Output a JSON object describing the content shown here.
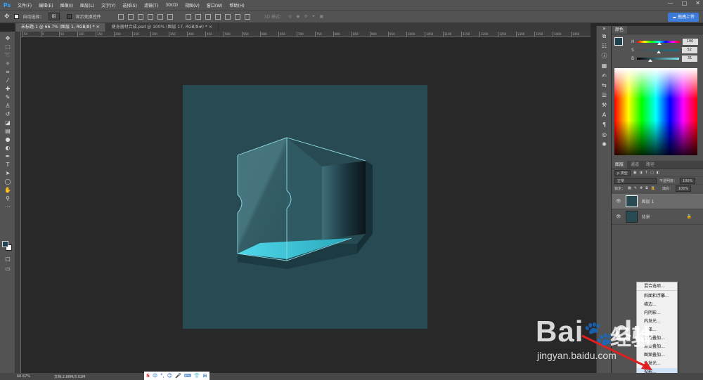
{
  "menubar": {
    "logo": "Ps",
    "items": [
      "文件(F)",
      "编辑(E)",
      "图像(I)",
      "图层(L)",
      "文字(Y)",
      "选择(S)",
      "滤镜(T)",
      "3D(D)",
      "视图(V)",
      "窗口(W)",
      "帮助(H)"
    ],
    "window_controls": [
      "—",
      "□",
      "✕"
    ]
  },
  "options": {
    "auto_select_label": "自动选择：",
    "auto_select_value": "组",
    "show_transform_label": "显示变换控件",
    "mode_label": "3D 模式：",
    "upload_label": "拖拽上传"
  },
  "tabs": [
    {
      "label": "未标题-1 @ 66.7% (图层 1, RGB/8) *",
      "close": "×"
    },
    {
      "label": "健身器材合成.psd @ 100% (图层 17, RGB/8#) *",
      "close": "×"
    }
  ],
  "ruler_ticks": [
    "50",
    "0",
    "50",
    "100",
    "150",
    "200",
    "250",
    "300",
    "350",
    "400",
    "450",
    "500",
    "550",
    "600",
    "650",
    "700",
    "750",
    "800",
    "850",
    "900",
    "950",
    "1000",
    "1050",
    "1100",
    "1150",
    "1200",
    "1250",
    "1300",
    "1350",
    "1400",
    "1450"
  ],
  "status": {
    "zoom": "66.67%",
    "doc": "文档:2.86M/3.02M"
  },
  "ime": {
    "logo": "S",
    "items": [
      "中",
      "°,",
      "☺",
      "🎤",
      "⌨",
      "👕",
      "⊞"
    ]
  },
  "color_panel": {
    "tab": "颜色",
    "h": {
      "label": "H",
      "value": "190",
      "pos": 0.53
    },
    "s": {
      "label": "S",
      "value": "52",
      "pos": 0.52
    },
    "b": {
      "label": "B",
      "value": "31",
      "pos": 0.31
    }
  },
  "layers_panel": {
    "tabs": [
      "图层",
      "通道",
      "路径"
    ],
    "filter_label": "ρ 类型",
    "blend_mode": "正常",
    "opacity_label": "不透明度：",
    "opacity_value": "100%",
    "lock_label": "锁定：",
    "fill_label": "填充：",
    "fill_value": "100%",
    "layers": [
      {
        "name": "图层 1",
        "selected": true
      },
      {
        "name": "背景",
        "selected": false,
        "locked": true
      }
    ]
  },
  "context_menu": [
    "混合选项...",
    "斜面和浮雕...",
    "描边...",
    "内阴影...",
    "内发光...",
    "光泽...",
    "颜色叠加...",
    "渐变叠加...",
    "图案叠加...",
    "外发光...",
    "投影..."
  ],
  "watermark": {
    "brand": "Bai",
    "brand2": "du",
    "product": "经验",
    "url": "jingyan.baidu.com"
  },
  "colors": {
    "artboard": "#284a52",
    "accent": "#31a8ff",
    "cyan_glow": "#3fd0e6"
  }
}
